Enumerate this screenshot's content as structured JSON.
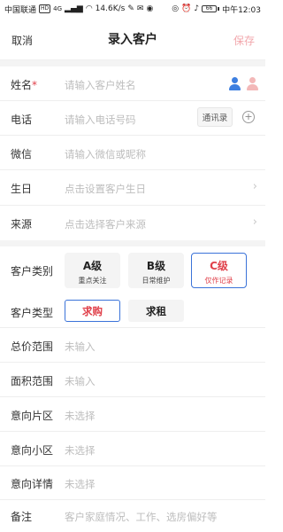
{
  "status_bar": {
    "carrier": "中国联通",
    "hd": "HD",
    "network": "4G",
    "speed": "14.6K/s",
    "battery": "66",
    "time": "中午12:03"
  },
  "nav": {
    "cancel_label": "取消",
    "title": "录入客户",
    "save_label": "保存"
  },
  "form": {
    "name": {
      "label": "姓名",
      "required_mark": "*",
      "placeholder": "请输入客户姓名"
    },
    "phone": {
      "label": "电话",
      "placeholder": "请输入电话号码",
      "contacts_label": "通讯录"
    },
    "wechat": {
      "label": "微信",
      "placeholder": "请输入微信或昵称"
    },
    "birthday": {
      "label": "生日",
      "placeholder": "点击设置客户生日"
    },
    "source": {
      "label": "来源",
      "placeholder": "点击选择客户来源"
    },
    "category": {
      "label": "客户类别",
      "options": [
        {
          "level": "A级",
          "desc": "重点关注",
          "selected": false
        },
        {
          "level": "B级",
          "desc": "日常维护",
          "selected": false
        },
        {
          "level": "C级",
          "desc": "仅作记录",
          "selected": true
        }
      ]
    },
    "type": {
      "label": "客户类型",
      "options": [
        {
          "label": "求购",
          "selected": true
        },
        {
          "label": "求租",
          "selected": false
        }
      ]
    },
    "price_range": {
      "label": "总价范围",
      "placeholder": "未输入"
    },
    "area_range": {
      "label": "面积范围",
      "placeholder": "未输入"
    },
    "district": {
      "label": "意向片区",
      "placeholder": "未选择"
    },
    "community": {
      "label": "意向小区",
      "placeholder": "未选择"
    },
    "details": {
      "label": "意向详情",
      "placeholder": "未选择"
    },
    "remark": {
      "label": "备注",
      "placeholder": "客户家庭情况、工作、选房偏好等"
    }
  },
  "icons": {
    "male": "person-icon",
    "female": "person-icon",
    "add": "plus-circle-icon",
    "arrow": "chevron-right-icon"
  },
  "colors": {
    "accent_red": "#e0404a",
    "accent_blue": "#3b73d9",
    "male_icon": "#3d7fe0",
    "female_icon": "#f3b8b8",
    "save_disabled": "#f2a7ac",
    "placeholder": "#bdbdbd",
    "section_gap": "#f4f4f4"
  }
}
